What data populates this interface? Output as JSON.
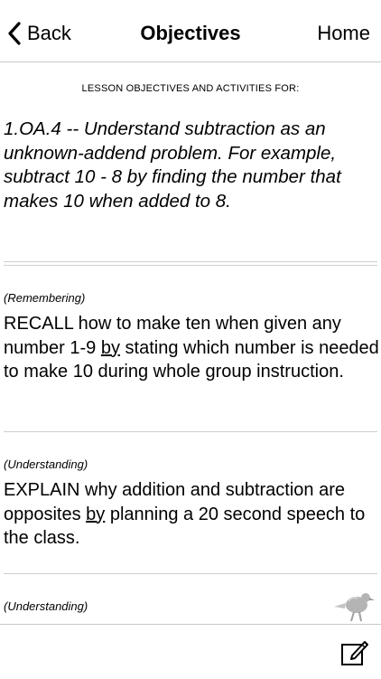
{
  "nav": {
    "back_label": "Back",
    "title": "Objectives",
    "home_label": "Home"
  },
  "lesson": {
    "header": "LESSON OBJECTIVES AND ACTIVITIES FOR:",
    "standard": "1.OA.4 -- Understand subtraction as an unknown-addend problem. For example, subtract 10 - 8 by finding the number that makes 10 when added to 8.",
    "objectives": [
      {
        "level": "(Remembering)",
        "before": "RECALL how to make ten when given any number 1-9 ",
        "underlined": "by",
        "after": " stating which number is needed to make 10 during whole group instruction."
      },
      {
        "level": "(Understanding)",
        "before": "EXPLAIN why addition and subtraction are opposites ",
        "underlined": "by",
        "after": " planning a 20 second speech to the class."
      },
      {
        "level": "(Understanding)"
      }
    ]
  },
  "icons": {
    "back": "chevron-left-icon",
    "bird": "kiwi-bird-icon",
    "edit": "edit-icon"
  }
}
